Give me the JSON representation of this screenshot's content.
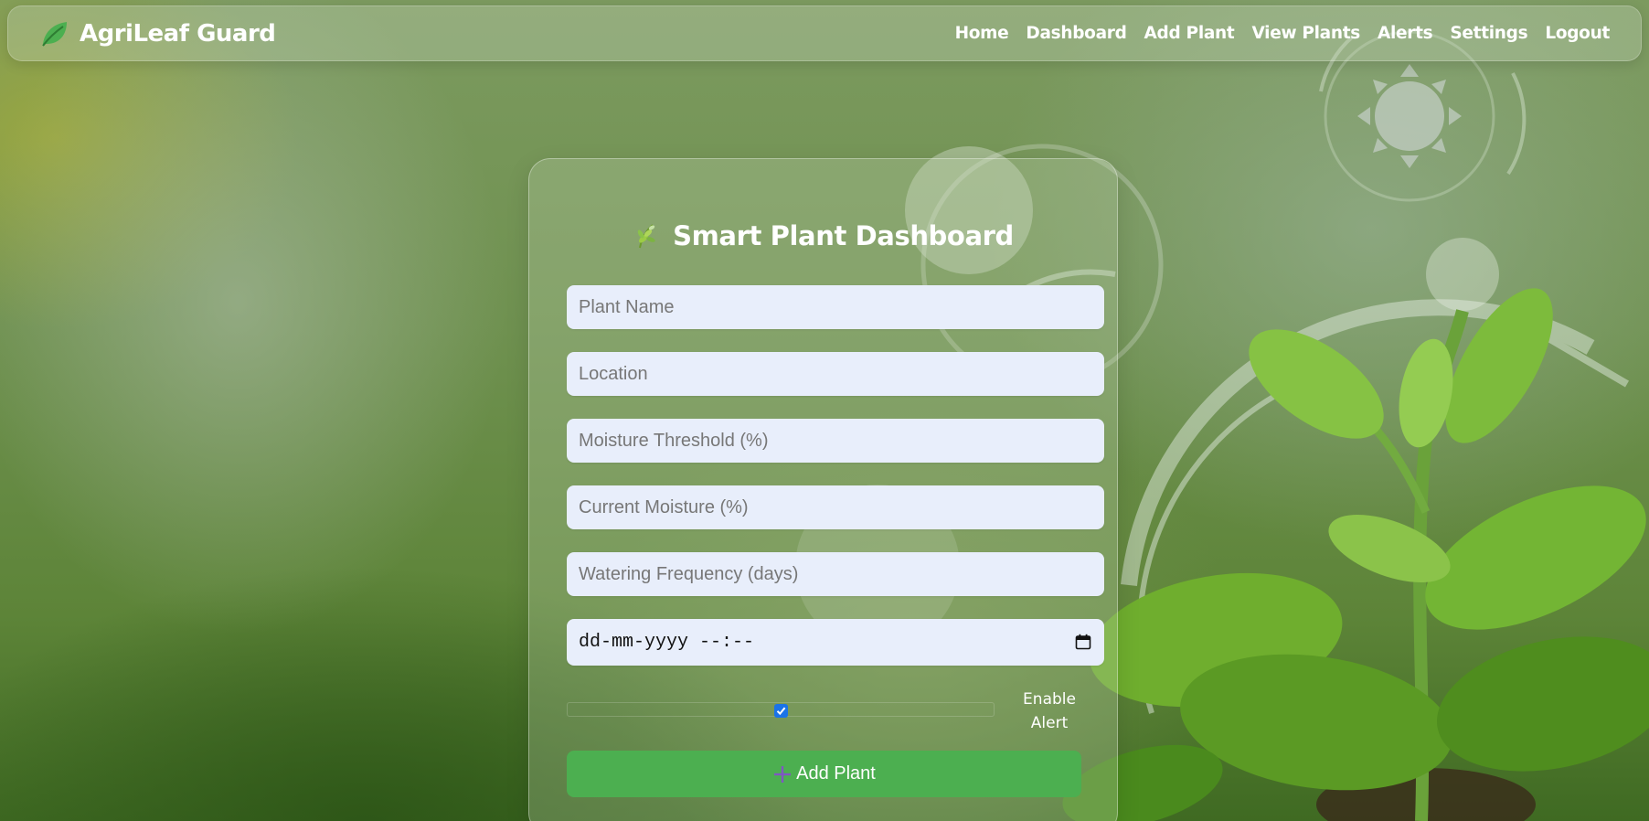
{
  "navbar": {
    "brand": "AgriLeaf Guard",
    "brand_icon": "leaf-icon",
    "links": [
      "Home",
      "Dashboard",
      "Add Plant",
      "View Plants",
      "Alerts",
      "Settings",
      "Logout"
    ]
  },
  "form": {
    "title": "Smart Plant Dashboard",
    "title_icon": "herb-icon",
    "fields": {
      "plant_name": "Plant Name",
      "location": "Location",
      "moisture_threshold": "Moisture Threshold (%)",
      "current_moisture": "Current Moisture (%)",
      "watering_frequency": "Watering Frequency (days)"
    },
    "date_value": "dd-mm-yyyy --:--",
    "enable_alert_checked": true,
    "enable_alert_label_line1": "Enable",
    "enable_alert_label_line2": "Alert",
    "submit_label": "Add Plant",
    "submit_icon": "plus-icon"
  },
  "colors": {
    "button_green": "#4caf50",
    "input_bg": "#e8eefb",
    "checkbox_blue": "#1a73e8"
  }
}
